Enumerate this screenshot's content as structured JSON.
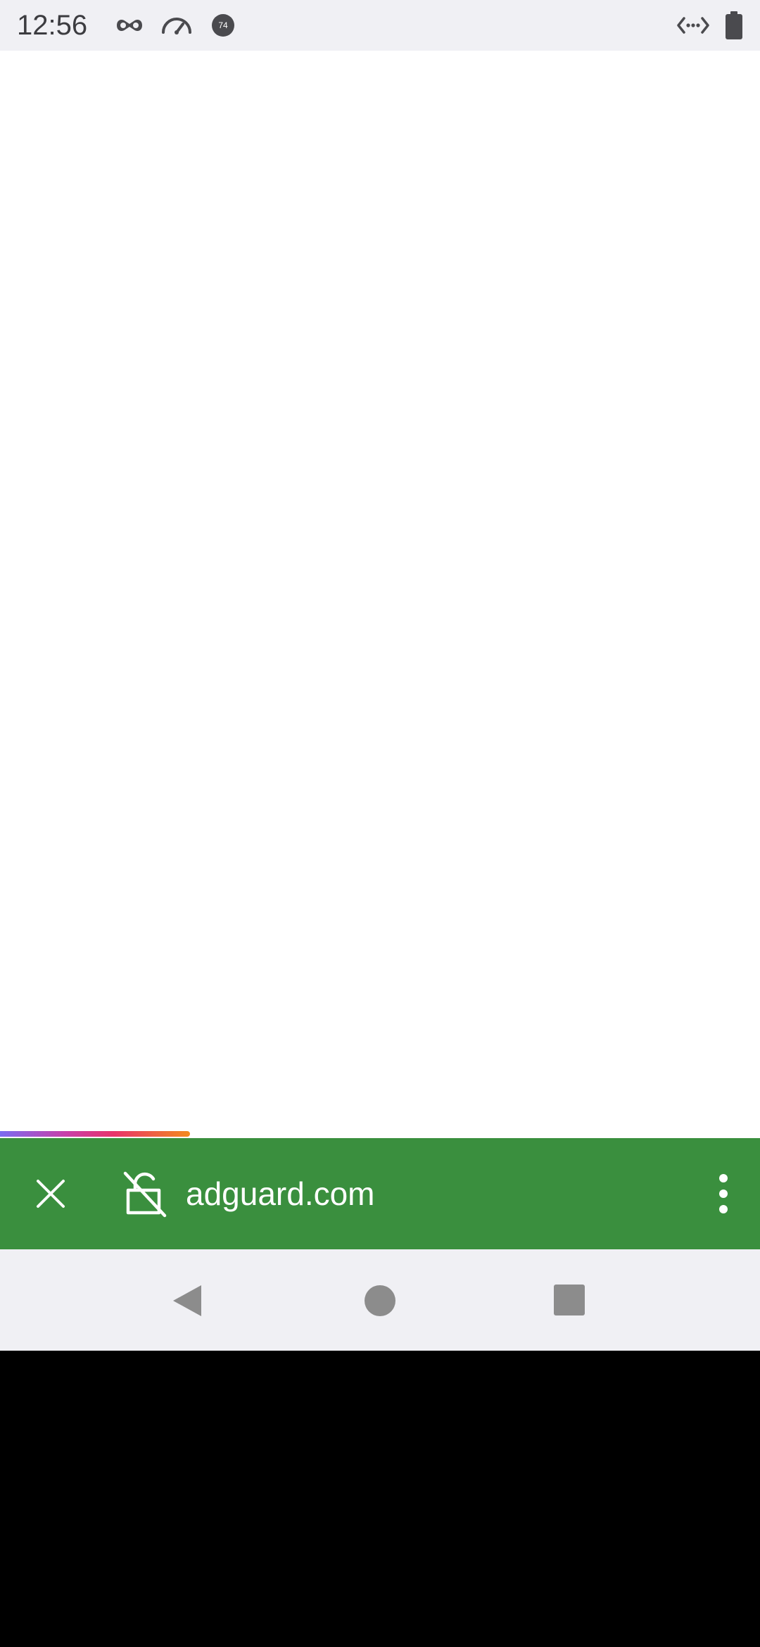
{
  "status_bar": {
    "time": "12:56",
    "notification_icons": [
      "incognito-icon",
      "speedometer-icon",
      "badge-74-icon"
    ],
    "badge_text": "74",
    "right_icons": [
      "data-saver-icon",
      "battery-icon"
    ]
  },
  "browser": {
    "url": "adguard.com",
    "load_progress": 0.25,
    "toolbar_color": "#3a8f3e",
    "icons": [
      "close-icon",
      "insecure-lock-icon",
      "overflow-menu-icon"
    ]
  },
  "navigation_bar": {
    "icons": [
      "back-icon",
      "home-icon",
      "recents-icon"
    ]
  }
}
